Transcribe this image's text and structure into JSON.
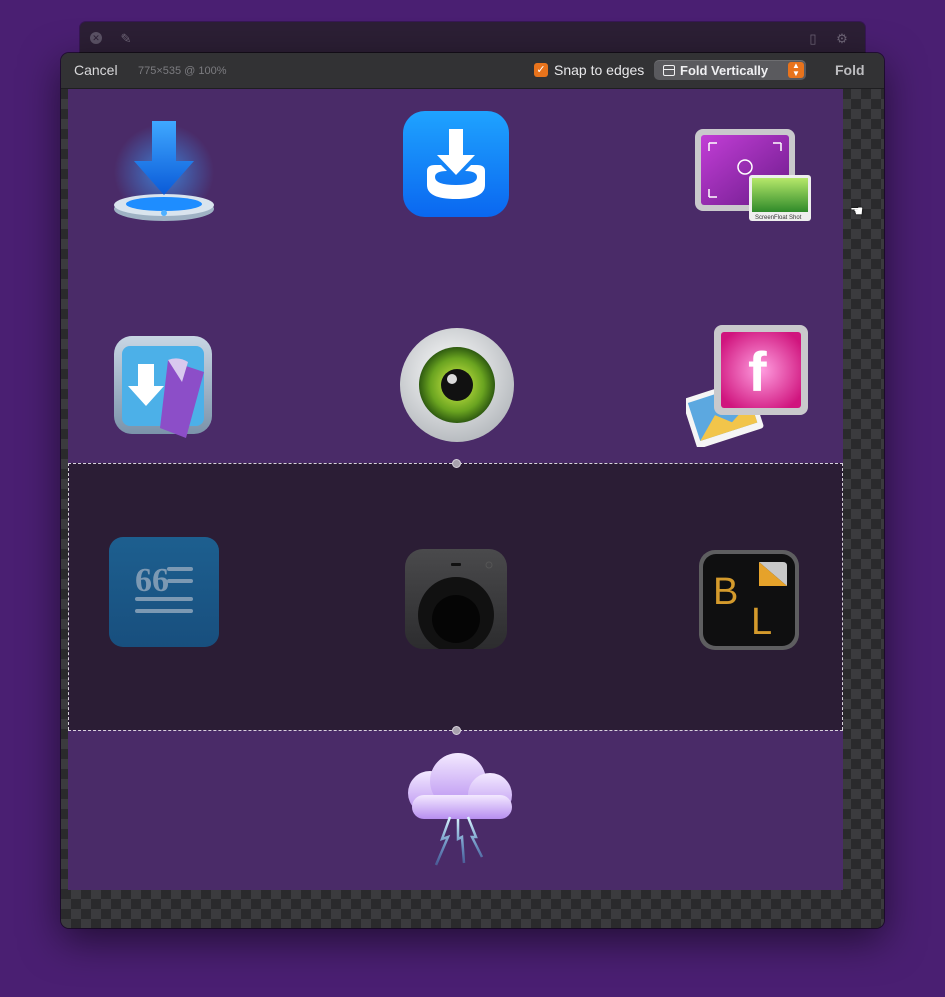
{
  "background_window": {
    "icons": [
      "close-icon",
      "edit-icon",
      "document-icon",
      "gear-icon"
    ]
  },
  "toolbar": {
    "cancel_label": "Cancel",
    "dimensions": "775×535 @ 100%",
    "snap_label": "Snap to edges",
    "snap_checked": true,
    "mode_label": "Fold Vertically",
    "fold_label": "Fold"
  },
  "colors": {
    "accent": "#e8731c",
    "desktop": "#4a1f72",
    "canvas": "#4a2b68",
    "fold_region": "#2b1d35"
  },
  "apps": [
    {
      "name": "downie-icon",
      "row": 1,
      "col": 1
    },
    {
      "name": "yoink-download-icon",
      "row": 1,
      "col": 2
    },
    {
      "name": "screenfloat-shot-icon",
      "row": 1,
      "col": 3,
      "label": "ScreenFloat Shot"
    },
    {
      "name": "transloader-icon",
      "row": 2,
      "col": 1
    },
    {
      "name": "eye-icon",
      "row": 2,
      "col": 2
    },
    {
      "name": "screenfloat-flipped-icon",
      "row": 2,
      "col": 3
    },
    {
      "name": "quotes-text-icon",
      "row": 3,
      "col": 1
    },
    {
      "name": "mac-mini-speaker-icon",
      "row": 3,
      "col": 2
    },
    {
      "name": "bl-document-icon",
      "row": 3,
      "col": 3,
      "label": "BL"
    },
    {
      "name": "thunder-cloud-icon",
      "row": 4,
      "col": 2
    }
  ]
}
